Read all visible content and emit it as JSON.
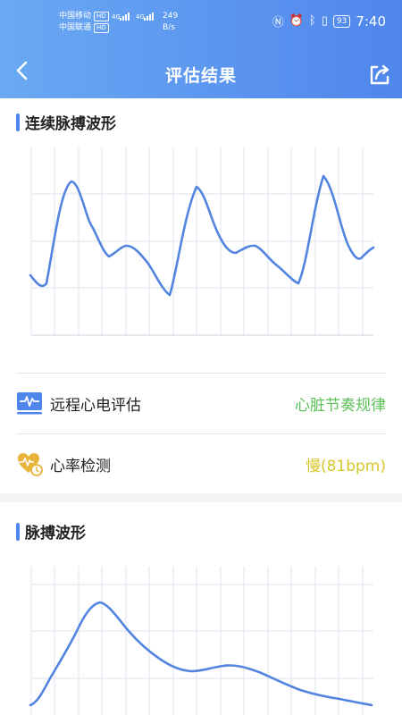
{
  "status_bar": {
    "carrier1": "中国移动",
    "carrier2": "中国联通",
    "hd_label": "HD",
    "net_type": "4G",
    "speed_value": "249",
    "speed_unit": "B/s",
    "battery": "93",
    "time": "7:40"
  },
  "header": {
    "title": "评估结果"
  },
  "pulse_continuous": {
    "title": "连续脉搏波形",
    "line_color": "#5385e0"
  },
  "rows": [
    {
      "label": "远程心电评估",
      "value": "心脏节奏规律",
      "value_color": "#5cc05a",
      "icon": "ecg-monitor-icon"
    },
    {
      "label": "心率检测",
      "value": "慢(81bpm)",
      "value_color": "#d6c62c",
      "icon": "heart-rate-icon"
    }
  ],
  "pulse_single": {
    "title": "脉搏波形",
    "line_color": "#5385e0"
  },
  "colors": {
    "header_start": "#6aa9f3",
    "header_end": "#4f86ec",
    "accent": "#4f86ec",
    "grid": "#dde4ee"
  }
}
